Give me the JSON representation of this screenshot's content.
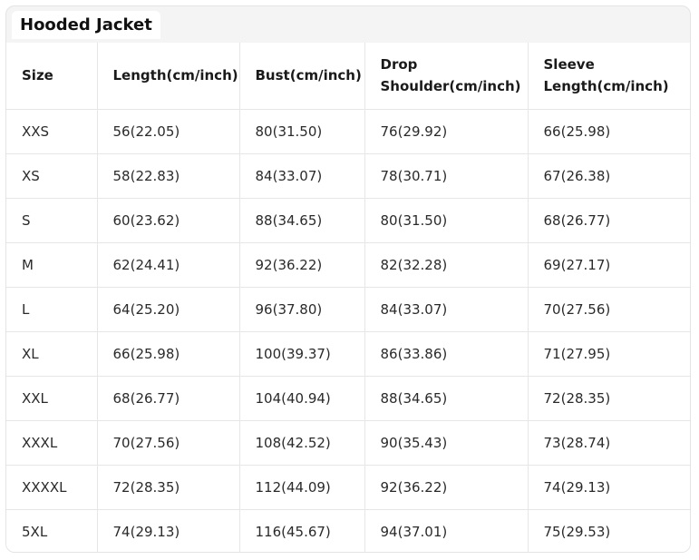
{
  "title": "Hooded Jacket",
  "table": {
    "headers": [
      [
        "Size"
      ],
      [
        "Length(cm/inch)"
      ],
      [
        "Bust(cm/inch)"
      ],
      [
        "Drop",
        "Shoulder(cm/inch)"
      ],
      [
        "Sleeve",
        "Length(cm/inch)"
      ]
    ],
    "rows": [
      [
        "XXS",
        "56(22.05)",
        "80(31.50)",
        "76(29.92)",
        "66(25.98)"
      ],
      [
        "XS",
        "58(22.83)",
        "84(33.07)",
        "78(30.71)",
        "67(26.38)"
      ],
      [
        "S",
        "60(23.62)",
        "88(34.65)",
        "80(31.50)",
        "68(26.77)"
      ],
      [
        "M",
        "62(24.41)",
        "92(36.22)",
        "82(32.28)",
        "69(27.17)"
      ],
      [
        "L",
        "64(25.20)",
        "96(37.80)",
        "84(33.07)",
        "70(27.56)"
      ],
      [
        "XL",
        "66(25.98)",
        "100(39.37)",
        "86(33.86)",
        "71(27.95)"
      ],
      [
        "XXL",
        "68(26.77)",
        "104(40.94)",
        "88(34.65)",
        "72(28.35)"
      ],
      [
        "XXXL",
        "70(27.56)",
        "108(42.52)",
        "90(35.43)",
        "73(28.74)"
      ],
      [
        "XXXXL",
        "72(28.35)",
        "112(44.09)",
        "92(36.22)",
        "74(29.13)"
      ],
      [
        "5XL",
        "74(29.13)",
        "116(45.67)",
        "94(37.01)",
        "75(29.53)"
      ]
    ]
  }
}
